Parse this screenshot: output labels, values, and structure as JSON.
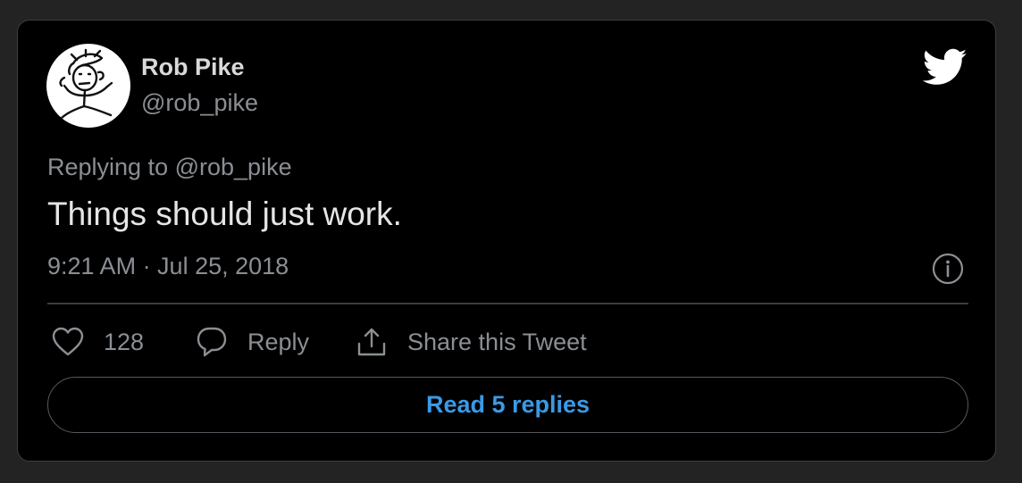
{
  "author": {
    "name": "Rob Pike",
    "handle": "@rob_pike",
    "avatar_icon": "stick-figure-avatar"
  },
  "logo_icon": "twitter-bird-icon",
  "reply_context": {
    "prefix": "Replying to",
    "mention": "@rob_pike"
  },
  "tweet": {
    "text": "Things should just work.",
    "timestamp": "9:21 AM · Jul 25, 2018"
  },
  "actions": {
    "like_count": "128",
    "reply_label": "Reply",
    "share_label": "Share this Tweet"
  },
  "read_replies_label": "Read 5 replies",
  "colors": {
    "background": "#232323",
    "card": "#000000",
    "border": "#3a3d41",
    "primary_text": "#e6e6e6",
    "secondary_text": "#8b8f94",
    "link_blue": "#3a9ae6"
  }
}
